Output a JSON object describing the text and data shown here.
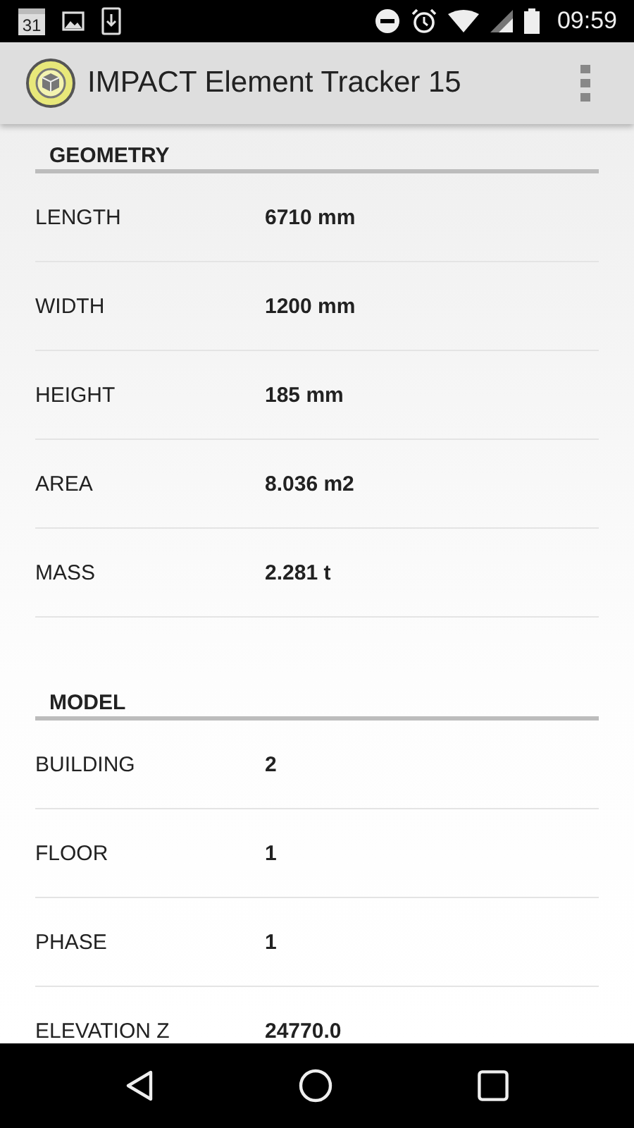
{
  "status_bar": {
    "calendar_day": "31",
    "time": "09:59"
  },
  "app_bar": {
    "title": "IMPACT Element Tracker 15"
  },
  "sections": [
    {
      "title": "GEOMETRY",
      "rows": [
        {
          "label": "LENGTH",
          "value": "6710 mm"
        },
        {
          "label": "WIDTH",
          "value": "1200 mm"
        },
        {
          "label": "HEIGHT",
          "value": "185 mm"
        },
        {
          "label": "AREA",
          "value": "8.036 m2"
        },
        {
          "label": "MASS",
          "value": "2.281 t"
        }
      ]
    },
    {
      "title": "MODEL",
      "rows": [
        {
          "label": "BUILDING",
          "value": "2"
        },
        {
          "label": "FLOOR",
          "value": "1"
        },
        {
          "label": "PHASE",
          "value": "1"
        },
        {
          "label": "ELEVATION Z",
          "value": "24770.0"
        }
      ]
    }
  ]
}
